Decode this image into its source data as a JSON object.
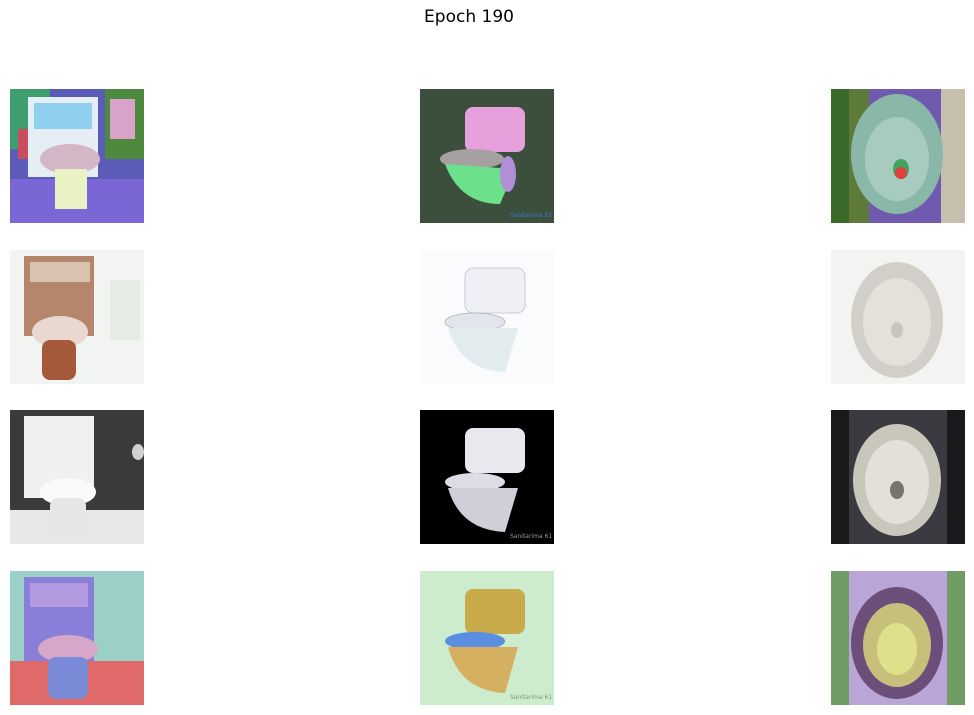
{
  "figure": {
    "title": "Epoch 190"
  },
  "grid": {
    "rows": [
      {
        "style": "segmentation-colored",
        "cells": [
          {
            "subject": "toilet-with-cabinet-front-view",
            "background": "#6a5acd"
          },
          {
            "subject": "toilet-side-view",
            "background": "#3c4f3c",
            "watermark": "Sanitarima 61"
          },
          {
            "subject": "toilet-bowl-top-view",
            "background": "#5d7a3a"
          }
        ]
      },
      {
        "style": "generated-realistic-light",
        "cells": [
          {
            "subject": "toilet-with-cabinet-front-view",
            "background": "#f2f4f2"
          },
          {
            "subject": "toilet-side-view",
            "background": "#fbfbfd"
          },
          {
            "subject": "toilet-bowl-top-view",
            "background": "#f3f3f2"
          }
        ]
      },
      {
        "style": "target-photo",
        "cells": [
          {
            "subject": "toilet-with-cabinet-front-view",
            "background": "#3a3a3a"
          },
          {
            "subject": "toilet-side-view",
            "background": "#000000",
            "watermark": "Sanitarima 61"
          },
          {
            "subject": "toilet-bowl-top-view",
            "background": "#1a1a1a"
          }
        ]
      },
      {
        "style": "generated-colorized",
        "cells": [
          {
            "subject": "toilet-with-cabinet-front-view",
            "background": "#9ad0c8"
          },
          {
            "subject": "toilet-side-view",
            "background": "#cdeccd",
            "watermark": "Sanitarima 61"
          },
          {
            "subject": "toilet-bowl-top-view",
            "background": "#6f9b65"
          }
        ]
      }
    ]
  }
}
